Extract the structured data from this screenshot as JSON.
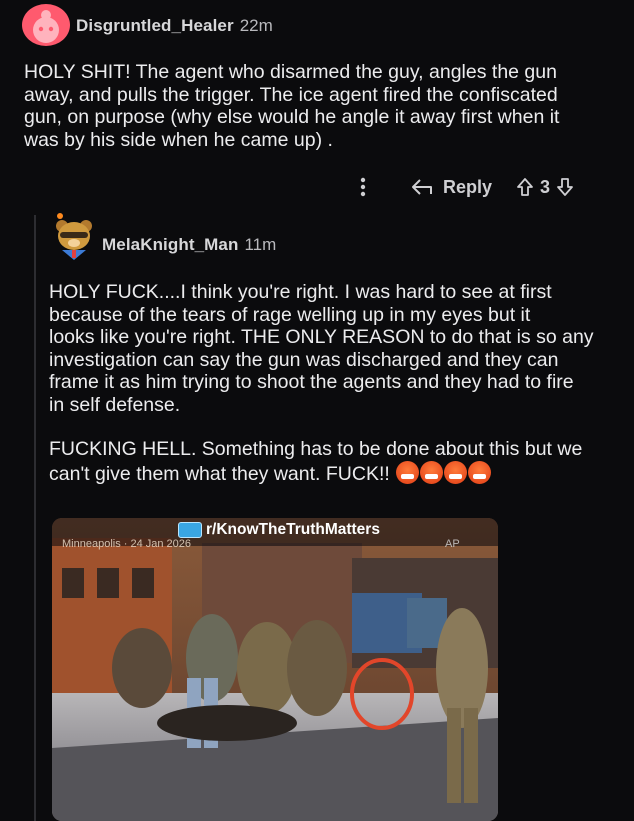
{
  "post": {
    "username": "Disgruntled_Healer",
    "time": "22m",
    "body_lines": [
      "HOLY SHIT! The agent who disarmed the guy, angles the gun",
      "away, and pulls the trigger. The ice agent fired the confiscated",
      "gun, on purpose (why else would he angle it away first when it",
      "was by his side when he came up) ."
    ],
    "reply_label": "Reply",
    "score": "3"
  },
  "reply": {
    "username": "MelaKnight_Man",
    "time": "11m",
    "para1_lines": [
      "HOLY FUCK....I think you're right. I was hard to see at first",
      "because of the tears of rage welling up in my eyes but it",
      "looks like you're right. THE ONLY REASON to do that is so any",
      "investigation can say the gun was discharged and they can",
      "frame it as him trying to shoot the agents and they had to fire",
      "in self defense."
    ],
    "para2_lines": [
      "FUCKING HELL. Something has to be done about this but we",
      "can't give them what they want. FUCK!!"
    ],
    "emoji_count_icon": "enraged-face-icon"
  },
  "media": {
    "subreddit": "r/KnowTheTruthMatters",
    "caption": "Minneapolis · 24 Jan 2026",
    "watermark": "AP"
  },
  "colors": {
    "background": "#0b0b0d",
    "text": "#ececee",
    "avatar": "#ff5a6e",
    "circle_annotation": "#e2462a"
  }
}
